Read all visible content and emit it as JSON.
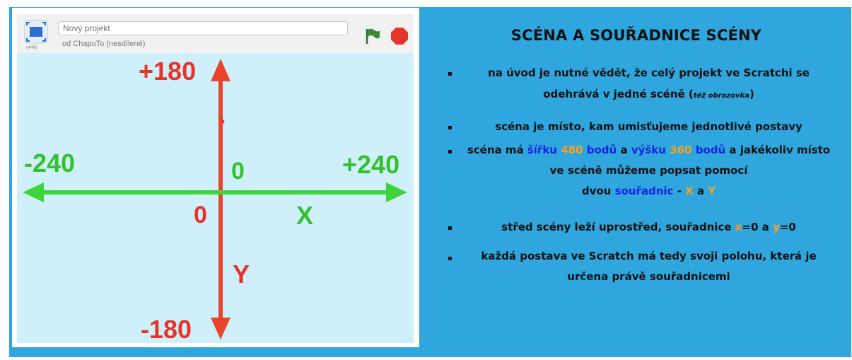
{
  "stage": {
    "project_title_placeholder": "Nový projekt",
    "author_text": "od ChapuTo (nesdílené)",
    "version_text": "v440",
    "fullscreen_icon": "fullscreen-icon",
    "green_flag_icon": "green-flag-icon",
    "stop_icon": "stop-icon",
    "colors": {
      "flag": "#3c8a3c",
      "stop": "#e5352a"
    }
  },
  "axes": {
    "y_top": "+180",
    "y_bottom": "-180",
    "x_left": "-240",
    "x_right": "+240",
    "origin_y_zero": "0",
    "origin_x_zero": "0",
    "x_name": "X",
    "y_name": "Y",
    "colors": {
      "y_axis": "#e8452a",
      "x_axis": "#3fd43a"
    }
  },
  "panel": {
    "title": "SCÉNA A SOUŘADNICE SCÉNY",
    "b1_line1": "na úvod je nutné vědět, že celý projekt ve Scratchi se",
    "b1_line2": "odehrává v jedné scéně (",
    "b1_note": "též obrazovka",
    "b1_close": ")",
    "b2": "scéna je místo, kam umisťujeme jednotlivé postavy",
    "b3_a": "scéna má ",
    "b3_sirku": "šířku",
    "b3_480": "480",
    "b3_bodu1": "bodů",
    "b3_and": " a ",
    "b3_vysku": "výšku",
    "b3_360": "360",
    "b3_bodu2": "bodů",
    "b3_rest": " a jakékoliv místo",
    "b3_line2": "ve scéně můžeme popsat pomocí",
    "b3_dvou": "dvou ",
    "b3_souradnic": "souřadnic",
    "b3_dash": " - ",
    "b3_x": "X",
    "b3_a2": " a ",
    "b3_y": "Y",
    "b4_a": "střed scény leží uprostřed, souřadnice ",
    "b4_x": "x",
    "b4_eq0a": "=0 a ",
    "b4_y": "y",
    "b4_eq0b": "=0",
    "b5_line1": "každá postava ve Scratch má tedy svoji polohu, která je",
    "b5_line2": "určena právě souřadnicemi",
    "colors": {
      "background": "#2fa6dd",
      "blue": "#1a21e6",
      "orange": "#ff9e1a"
    }
  }
}
